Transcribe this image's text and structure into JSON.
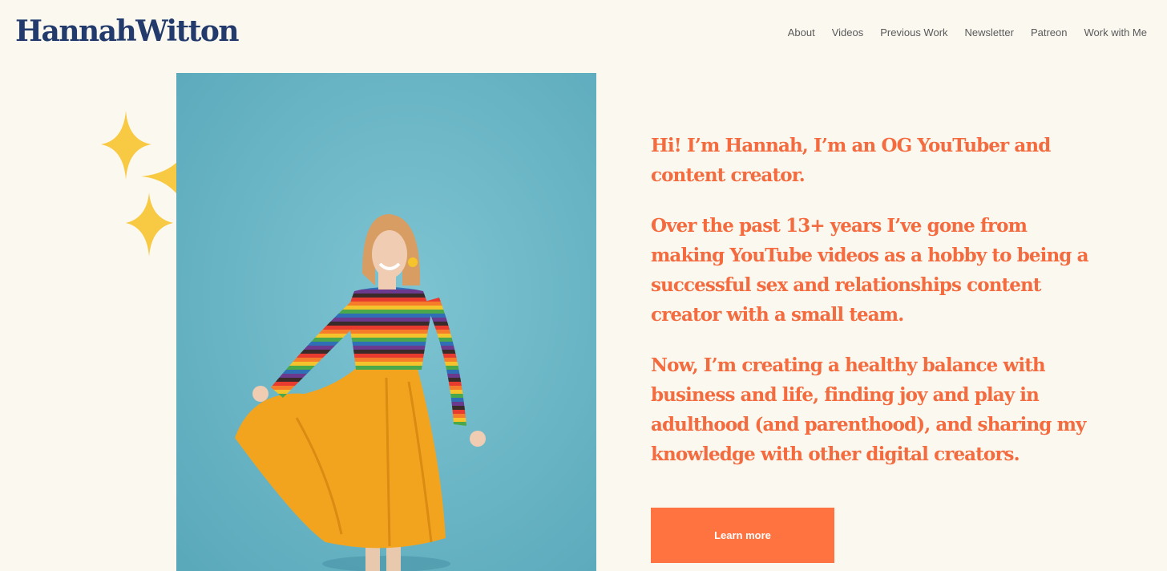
{
  "header": {
    "logo_text": "HannahWitton",
    "nav": [
      "About",
      "Videos",
      "Previous Work",
      "Newsletter",
      "Patreon",
      "Work with Me"
    ]
  },
  "hero": {
    "paragraphs": [
      "Hi! I’m Hannah, I’m an OG YouTuber and content creator.",
      "Over the past 13+ years I’ve gone from making YouTube videos as a hobby to being a successful sex and relationships content creator with a small team.",
      "Now, I’m creating a healthy balance with business and life, finding joy and play in adulthood (and parenthood), and sharing my knowledge with other digital creators."
    ],
    "cta_label": "Learn more",
    "photo_icon": "woman-portrait-photo",
    "sparkle_icon": "sparkles-icon"
  },
  "colors": {
    "background": "#fbf8f0",
    "logo": "#233b6c",
    "headline": "#f36b3e",
    "button": "#ff7341",
    "photo_bg": "#6bb5c6",
    "sparkle": "#f8c942"
  }
}
